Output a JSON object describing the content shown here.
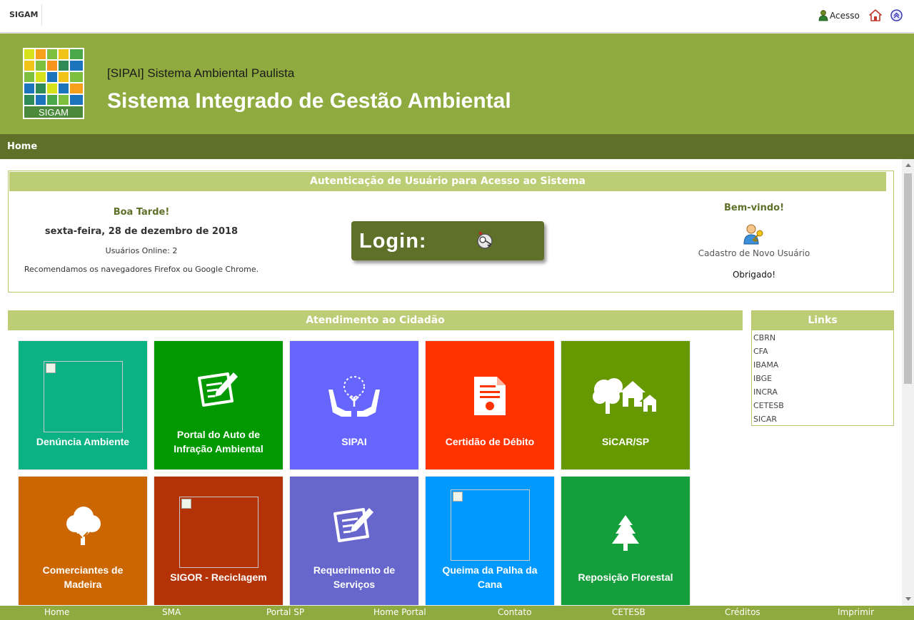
{
  "topbar": {
    "brand": "SIGAM",
    "acesso": "Acesso",
    "icons": [
      "user-icon",
      "home-icon",
      "back-to-top-icon"
    ]
  },
  "header": {
    "logo_text": "SIGAM",
    "subtitle": "[SIPAI] Sistema Ambiental Paulista",
    "title": "Sistema Integrado de Gestão Ambiental"
  },
  "nav": {
    "home": "Home"
  },
  "auth": {
    "heading": "Autenticação de Usuário para Acesso ao Sistema",
    "greeting": "Boa Tarde!",
    "date": "sexta-feira, 28 de dezembro de 2018",
    "online": "Usuários Online: 2",
    "browsers": "Recomendamos os navegadores Firefox ou Google Chrome.",
    "login_label": "Login:",
    "welcome": "Bem-vindo!",
    "register": "Cadastro de Novo Usuário",
    "thanks": "Obrigado!"
  },
  "citizen": {
    "heading": "Atendimento ao Cidadão",
    "tiles": [
      {
        "label": "Denúncia Ambiente",
        "color": "#0bb384",
        "icon": "broken-image-icon"
      },
      {
        "label": "Portal do Auto de Infração Ambiental",
        "color": "#009900",
        "icon": "form-pen-icon"
      },
      {
        "label": "SIPAI",
        "color": "#6666ff",
        "icon": "hands-tree-icon"
      },
      {
        "label": "Certidão de Débito",
        "color": "#ff3300",
        "icon": "certificate-icon"
      },
      {
        "label": "SiCAR/SP",
        "color": "#669900",
        "icon": "rural-property-icon"
      },
      {
        "label": "Comerciantes de Madeira",
        "color": "#cc6600",
        "icon": "tree-icon"
      },
      {
        "label": "SIGOR - Reciclagem",
        "color": "#b33306",
        "icon": "broken-image-icon"
      },
      {
        "label": "Requerimento de Serviços",
        "color": "#6666cc",
        "icon": "form-pen-icon"
      },
      {
        "label": "Queima da Palha da Cana",
        "color": "#0099ff",
        "icon": "broken-image-icon"
      },
      {
        "label": "Reposição Florestal",
        "color": "#149e3c",
        "icon": "pine-tree-icon"
      }
    ]
  },
  "links": {
    "heading": "Links",
    "items": [
      "CBRN",
      "CFA",
      "IBAMA",
      "IBGE",
      "INCRA",
      "CETESB",
      "SICAR"
    ]
  },
  "footer": {
    "items": [
      "Home",
      "SMA",
      "Portal SP",
      "Home Portal",
      "Contato",
      "CETESB",
      "Créditos",
      "Imprimir"
    ]
  },
  "colors": {
    "header": "#8faa3f",
    "nav": "#5f7028",
    "section_bar": "#bccd75"
  }
}
